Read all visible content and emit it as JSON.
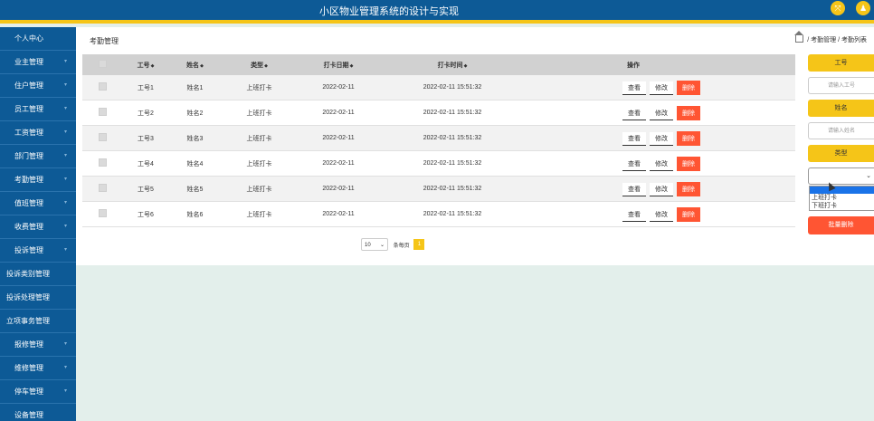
{
  "app": {
    "title": "小区物业管理系统的设计与实现"
  },
  "topbar": {
    "icon1": "fullscreen-icon",
    "icon2": "user-icon"
  },
  "sidebar": {
    "items": [
      {
        "label": "个人中心"
      },
      {
        "label": "业主管理"
      },
      {
        "label": "住户管理"
      },
      {
        "label": "员工管理"
      },
      {
        "label": "工资管理"
      },
      {
        "label": "部门管理"
      },
      {
        "label": "考勤管理"
      },
      {
        "label": "值班管理"
      },
      {
        "label": "收费管理"
      },
      {
        "label": "投诉管理"
      },
      {
        "label": "投诉类别管理"
      },
      {
        "label": "投诉处理管理"
      },
      {
        "label": "立项事务管理"
      },
      {
        "label": "报修管理"
      },
      {
        "label": "维修管理"
      },
      {
        "label": "停车管理"
      },
      {
        "label": "设备管理"
      }
    ]
  },
  "page": {
    "title": "考勤管理",
    "breadcrumb": {
      "level1": "考勤管理",
      "separator": "/",
      "level2": "考勤列表"
    }
  },
  "table": {
    "headers": {
      "id": "工号",
      "name": "姓名",
      "type": "类型",
      "date": "打卡日期",
      "time": "打卡时间",
      "actions": "操作"
    },
    "rows": [
      {
        "id": "工号1",
        "name": "姓名1",
        "type": "上班打卡",
        "date": "2022-02-11",
        "time": "2022-02-11 15:51:32"
      },
      {
        "id": "工号2",
        "name": "姓名2",
        "type": "上班打卡",
        "date": "2022-02-11",
        "time": "2022-02-11 15:51:32"
      },
      {
        "id": "工号3",
        "name": "姓名3",
        "type": "上班打卡",
        "date": "2022-02-11",
        "time": "2022-02-11 15:51:32"
      },
      {
        "id": "工号4",
        "name": "姓名4",
        "type": "上班打卡",
        "date": "2022-02-11",
        "time": "2022-02-11 15:51:32"
      },
      {
        "id": "工号5",
        "name": "姓名5",
        "type": "上班打卡",
        "date": "2022-02-11",
        "time": "2022-02-11 15:51:32"
      },
      {
        "id": "工号6",
        "name": "姓名6",
        "type": "上班打卡",
        "date": "2022-02-11",
        "time": "2022-02-11 15:51:32"
      }
    ],
    "actions": {
      "view": "查看",
      "edit": "修改",
      "delete": "删除"
    }
  },
  "pager": {
    "page_size": "10",
    "per_page_text": "条每页",
    "current_page": "1"
  },
  "search": {
    "id_label": "工号",
    "id_placeholder": "请输入工号",
    "name_label": "姓名",
    "name_placeholder": "请输入姓名",
    "type_label": "类型",
    "type_value": "",
    "type_options": [
      "上班打卡",
      "下班打卡"
    ],
    "batch_delete": "批量删除"
  },
  "colors": {
    "primary": "#0d5a96",
    "accent": "#f5c518",
    "danger": "#ff5533"
  }
}
